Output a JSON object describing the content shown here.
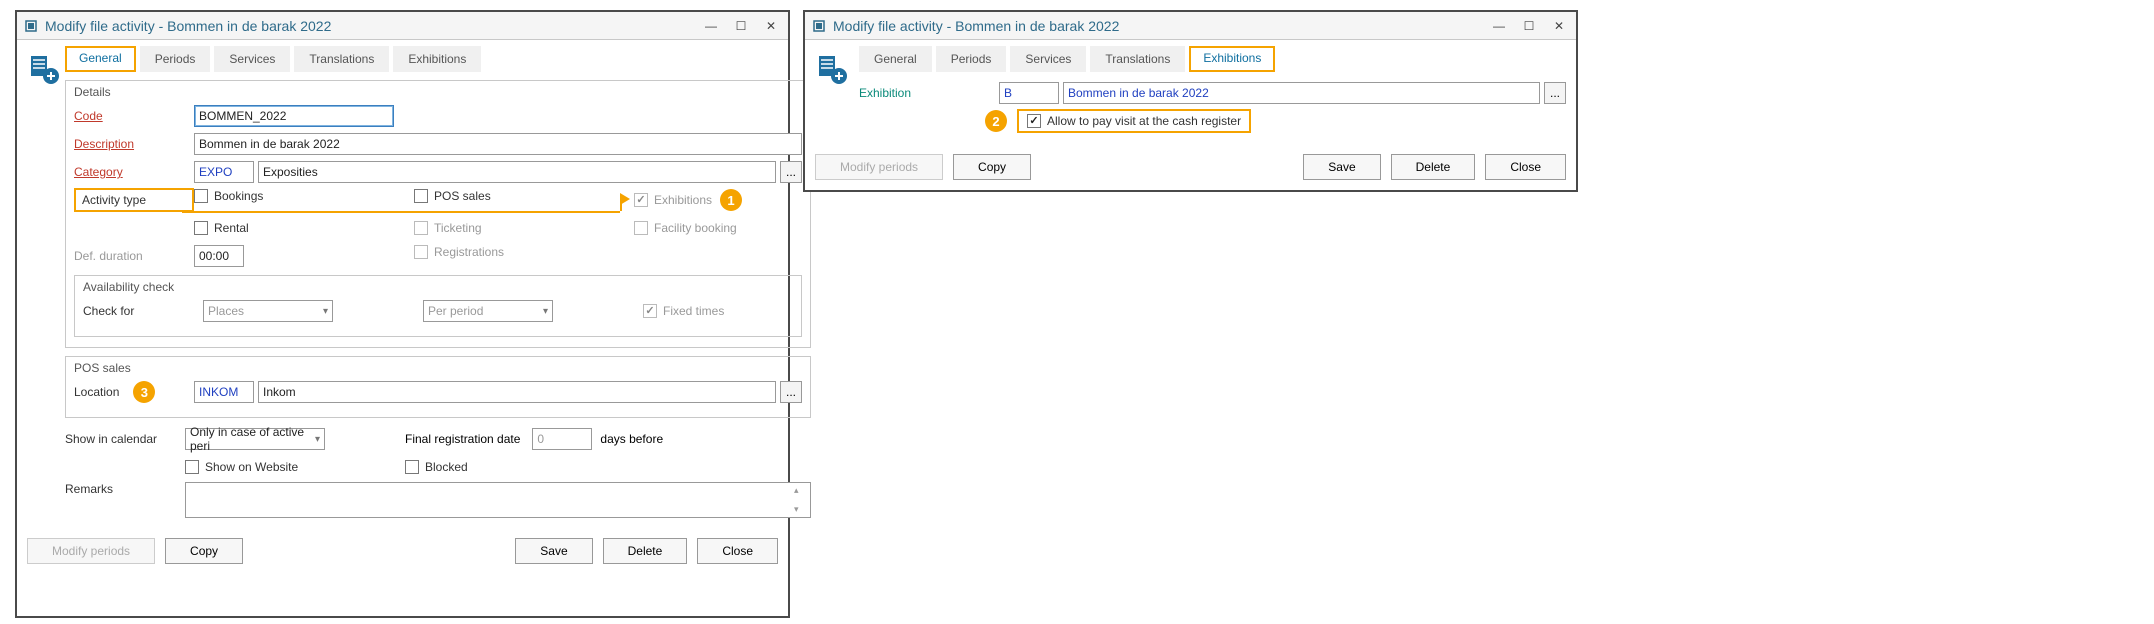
{
  "window_left": {
    "title": "Modify file activity - Bommen in de barak 2022",
    "tabs": [
      "General",
      "Periods",
      "Services",
      "Translations",
      "Exhibitions"
    ],
    "active_tab": "General",
    "callouts": {
      "exhibitions": "1",
      "location": "3"
    },
    "details": {
      "group_title": "Details",
      "code_label": "Code",
      "code_value": "BOMMEN_2022",
      "description_label": "Description",
      "description_value": "Bommen in de barak 2022",
      "category_label": "Category",
      "category_code": "EXPO",
      "category_value": "Exposities",
      "activity_type_label": "Activity type",
      "act_types": {
        "bookings": "Bookings",
        "pos_sales": "POS sales",
        "exhibitions": "Exhibitions",
        "rental": "Rental",
        "ticketing": "Ticketing",
        "facility": "Facility booking",
        "registrations": "Registrations"
      },
      "def_duration_label": "Def. duration",
      "def_duration_value": "00:00"
    },
    "availability": {
      "group_title": "Availability check",
      "check_for_label": "Check for",
      "check_for_value": "Places",
      "period_value": "Per period",
      "fixed_times_label": "Fixed times"
    },
    "pos": {
      "group_title": "POS sales",
      "location_label": "Location",
      "location_code": "INKOM",
      "location_value": "Inkom"
    },
    "calendar": {
      "show_label": "Show in calendar",
      "show_value": "Only in case of active peri",
      "final_reg_label": "Final registration date",
      "final_reg_value": "0",
      "days_before": "days before",
      "website": "Show on Website",
      "blocked": "Blocked",
      "remarks_label": "Remarks"
    },
    "footer": {
      "modify_periods": "Modify periods",
      "copy": "Copy",
      "save": "Save",
      "delete": "Delete",
      "close": "Close"
    }
  },
  "window_right": {
    "title": "Modify file activity - Bommen in de barak 2022",
    "tabs": [
      "General",
      "Periods",
      "Services",
      "Translations",
      "Exhibitions"
    ],
    "active_tab": "Exhibitions",
    "callout": "2",
    "exhibition_label": "Exhibition",
    "exhibition_code": "B",
    "exhibition_value": "Bommen in de barak 2022",
    "allow_pay_label": "Allow to pay visit at the cash register",
    "footer": {
      "modify_periods": "Modify periods",
      "copy": "Copy",
      "save": "Save",
      "delete": "Delete",
      "close": "Close"
    }
  },
  "icons": {
    "app": "app-icon",
    "minimize": "minimize-icon",
    "maximize": "maximize-icon",
    "close": "close-icon",
    "ellipsis": "ellipsis-icon"
  }
}
